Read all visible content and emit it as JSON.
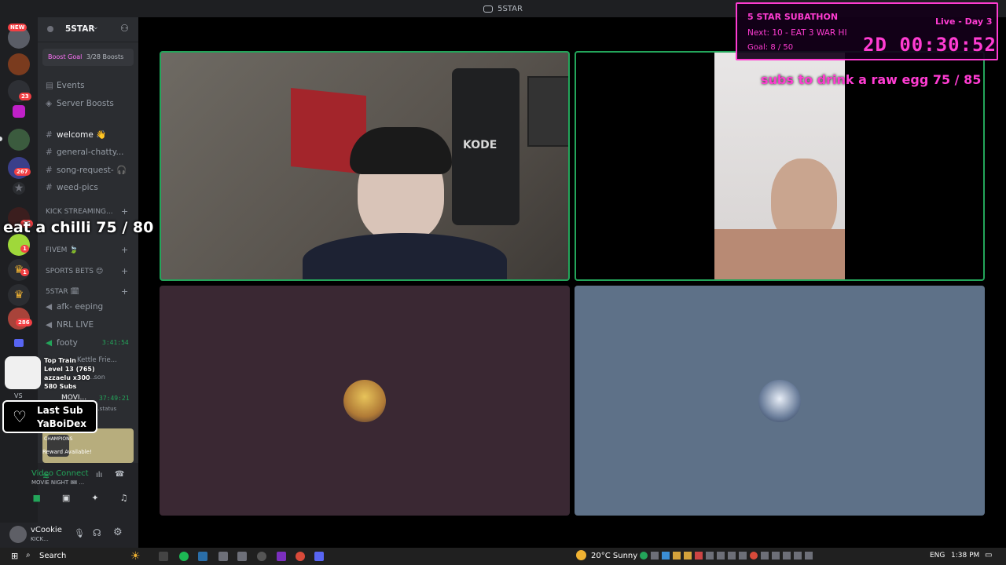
{
  "window": {
    "title": "5STAR"
  },
  "rail": {
    "new_badge": "NEW",
    "badges": [
      "23",
      "267",
      "15",
      "1",
      "1",
      "1",
      "286"
    ],
    "vs_label": "VS"
  },
  "server": {
    "name": "5STAR",
    "boost_goal": "Boost Goal",
    "boost_count": "3/28 Boosts",
    "events": "Events",
    "server_boosts": "Server Boosts",
    "channels": [
      "welcome 👋",
      "general-chatty...",
      "song-request- 🎧",
      "weed-pics"
    ],
    "categories": {
      "kick": "KICK STREAMING...",
      "fivem": "FIVEM 🍃",
      "sports": "SPORTS BETS 😊",
      "fivestar": "5STAR 🗓"
    },
    "voice": [
      {
        "name": "afk- eeping",
        "time": ""
      },
      {
        "name": "NRL LIVE",
        "time": ""
      },
      {
        "name": "footy",
        "time": "3:41:54"
      },
      {
        "name": "Kettle Frie...",
        "time": ""
      },
      {
        "name": "...son",
        "time": ""
      },
      {
        "name": "MOVI...",
        "time": "37:49:21"
      }
    ],
    "status_hint": "...status",
    "reward": {
      "title": "CHAMPIONS",
      "subtitle": "Reward Available!"
    }
  },
  "voice_panel": {
    "status": "Video Connect",
    "channel": "MOVIE NIGHT 🎟 ..."
  },
  "user": {
    "name": "vCookie",
    "status": "KICK..."
  },
  "overlays": {
    "chilli": "eat a chilli  75 / 80",
    "egg": "subs to drink a raw egg  75 / 85",
    "top_train": {
      "label": "Top Train",
      "level": "Level 13  (765)",
      "user": "azzaelu x300",
      "subs": "580 Subs"
    },
    "last_sub": {
      "label": "Last Sub",
      "name": "YaBoiDex"
    },
    "subathon": {
      "title": "5 STAR SUBATHON",
      "status": "Live - Day 3",
      "next": "Next: 10 - EAT 3 WAR HI",
      "goal": "Goal: 8 / 50",
      "timer": "2D  00:30:52"
    }
  },
  "video": {
    "poster_text": "KODE"
  },
  "taskbar": {
    "search": "Search",
    "weather": "20°C  Sunny",
    "lang": "ENG",
    "time": "1:38 PM"
  },
  "colors": {
    "accent_green": "#23a55a",
    "overlay_pink": "#ff3cd2",
    "tile_left": "#3a2833",
    "tile_right": "#5e7188"
  }
}
